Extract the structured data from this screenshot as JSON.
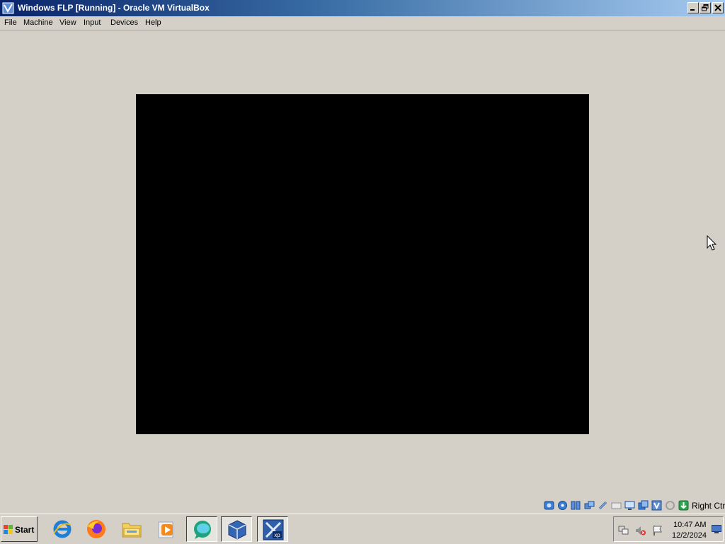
{
  "window": {
    "title": "Windows FLP [Running] - Oracle VM VirtualBox",
    "icon": "virtualbox-icon",
    "controls": [
      "minimize-icon",
      "restore-icon",
      "close-icon"
    ]
  },
  "menu": {
    "items": [
      {
        "label": "File"
      },
      {
        "label": "Machine"
      },
      {
        "label": "View"
      },
      {
        "label": "Input"
      },
      {
        "label": "Devices"
      },
      {
        "label": "Help"
      }
    ]
  },
  "vm_display": {
    "state": "black screen",
    "background": "#000000"
  },
  "status_bar": {
    "indicators": [
      "hard-disk-icon",
      "optical-drive-icon",
      "audio-icon",
      "network-icon",
      "usb-icon",
      "shared-folders-icon",
      "display-icon",
      "video-capture-icon",
      "virtualization-icon",
      "mouse-integration-icon",
      "cpu-icon",
      "keyboard-icon"
    ],
    "host_key": "Right Ctrl"
  },
  "taskbar": {
    "start_label": "Start",
    "apps": [
      {
        "name": "internet-explorer-icon"
      },
      {
        "name": "firefox-icon"
      },
      {
        "name": "file-explorer-icon"
      },
      {
        "name": "media-player-icon"
      },
      {
        "name": "chat-app-icon"
      },
      {
        "name": "virtualbox-icon"
      },
      {
        "name": "windows-xp-vm-icon"
      }
    ],
    "tray": {
      "icons": [
        "network-tray-icon",
        "volume-muted-icon",
        "flag-icon"
      ],
      "time": "10:47 AM",
      "date": "12/2/2024"
    }
  },
  "colors": {
    "title_bar_start": "#0a246a",
    "title_bar_end": "#a6caf0",
    "face": "#d4d0c8"
  }
}
